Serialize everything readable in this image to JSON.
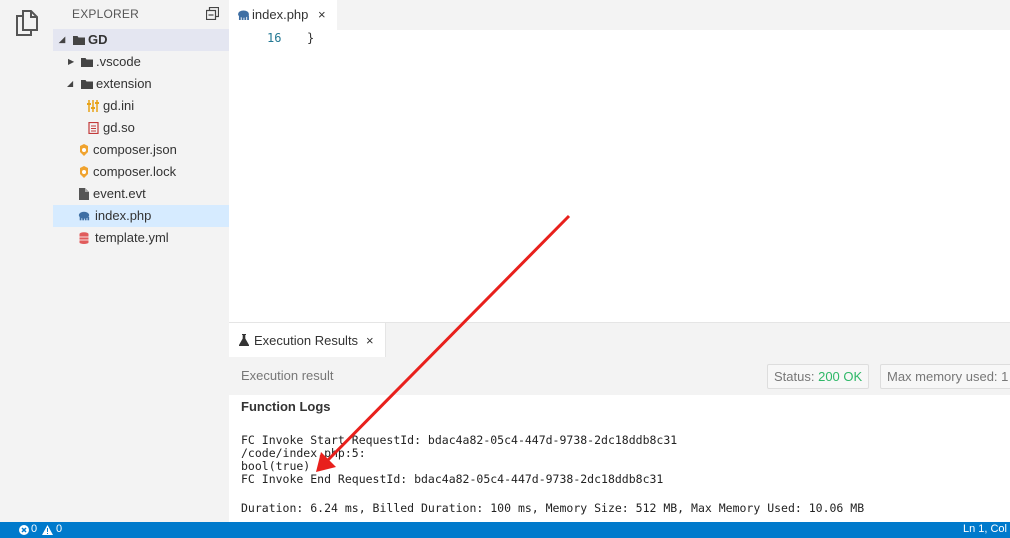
{
  "sidebar": {
    "title": "EXPLORER",
    "root": "GD",
    "items": [
      {
        "label": ".vscode",
        "icon": "folder-icon"
      },
      {
        "label": "extension",
        "icon": "folder-icon"
      },
      {
        "label": "gd.ini",
        "icon": "settings-file-icon"
      },
      {
        "label": "gd.so",
        "icon": "binary-file-icon"
      },
      {
        "label": "composer.json",
        "icon": "composer-icon"
      },
      {
        "label": "composer.lock",
        "icon": "composer-icon"
      },
      {
        "label": "event.evt",
        "icon": "file-icon"
      },
      {
        "label": "index.php",
        "icon": "php-elephant-icon"
      },
      {
        "label": "template.yml",
        "icon": "database-icon"
      }
    ]
  },
  "editor": {
    "tab_label": "index.php",
    "tab_close": "×",
    "line_number": "16",
    "line_text": "}"
  },
  "panel": {
    "tab_label": "Execution Results",
    "tab_close": "×",
    "result_label": "Execution result",
    "status_label": "Status:",
    "status_value": "200 OK",
    "memory_label": "Max memory used: 1",
    "logs_heading": "Function Logs",
    "logs": [
      "FC Invoke Start RequestId: bdac4a82-05c4-447d-9738-2dc18ddb8c31",
      "/code/index.php:5:",
      "bool(true)",
      "FC Invoke End RequestId: bdac4a82-05c4-447d-9738-2dc18ddb8c31",
      "Duration: 6.24 ms, Billed Duration: 100 ms, Memory Size: 512 MB, Max Memory Used: 10.06 MB"
    ]
  },
  "statusbar": {
    "errors": "0",
    "warnings": "0",
    "cursor": "Ln 1, Col"
  },
  "colors": {
    "statusbar": "#007acc",
    "status_ok": "#2fb868",
    "arrow": "#e8201c",
    "selection": "#d6ebff"
  }
}
